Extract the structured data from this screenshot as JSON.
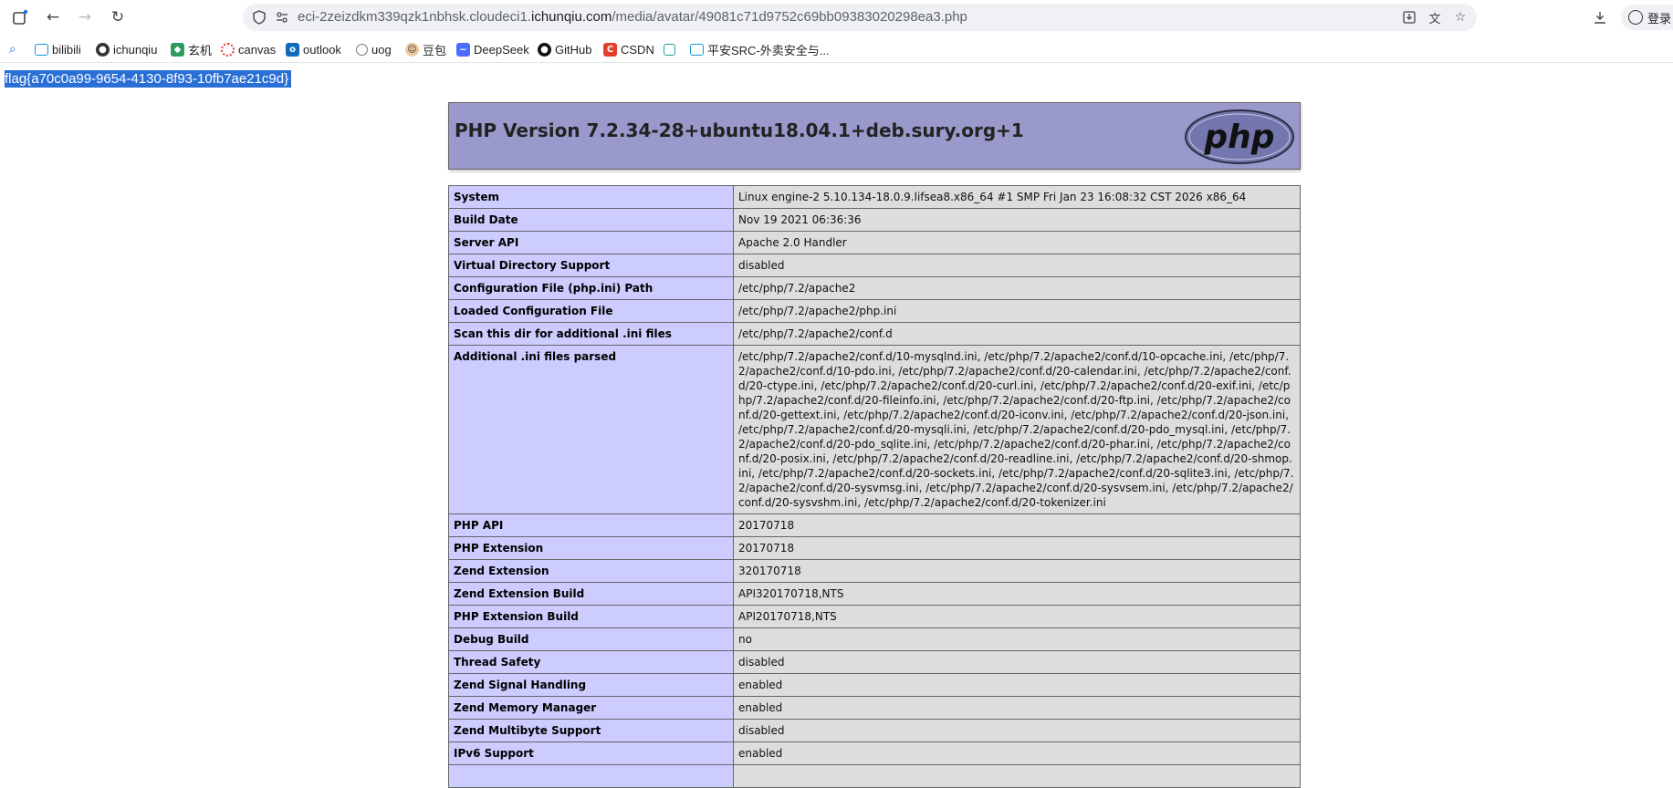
{
  "browser": {
    "url_prefix": "eci-2zeizdkm339qzk1nbhsk.cloudeci1.",
    "url_host": "ichunqiu.com",
    "url_path": "/media/avatar/49081c71d9752c69bb09383020298ea3.php",
    "profile_label": "登录",
    "bookmarks": [
      "bilibili",
      "ichunqiu",
      "玄机",
      "canvas",
      "outlook",
      "uog",
      "豆包",
      "DeepSeek",
      "GitHub",
      "CSDN",
      "",
      "平安SRC-外卖安全与..."
    ]
  },
  "page": {
    "flag": "flag{a70c0a99-9654-4130-8f93-10fb7ae21c9d}",
    "php_version_title": "PHP Version 7.2.34-28+ubuntu18.04.1+deb.sury.org+1",
    "logo_text": "php",
    "rows": [
      {
        "key": "System",
        "value": "Linux engine-2 5.10.134-18.0.9.lifsea8.x86_64 #1 SMP Fri Jan 23 16:08:32 CST 2026 x86_64"
      },
      {
        "key": "Build Date",
        "value": "Nov 19 2021 06:36:36"
      },
      {
        "key": "Server API",
        "value": "Apache 2.0 Handler"
      },
      {
        "key": "Virtual Directory Support",
        "value": "disabled"
      },
      {
        "key": "Configuration File (php.ini) Path",
        "value": "/etc/php/7.2/apache2"
      },
      {
        "key": "Loaded Configuration File",
        "value": "/etc/php/7.2/apache2/php.ini"
      },
      {
        "key": "Scan this dir for additional .ini files",
        "value": "/etc/php/7.2/apache2/conf.d"
      },
      {
        "key": "Additional .ini files parsed",
        "value": "/etc/php/7.2/apache2/conf.d/10-mysqlnd.ini, /etc/php/7.2/apache2/conf.d/10-opcache.ini, /etc/php/7.2/apache2/conf.d/10-pdo.ini, /etc/php/7.2/apache2/conf.d/20-calendar.ini, /etc/php/7.2/apache2/conf.d/20-ctype.ini, /etc/php/7.2/apache2/conf.d/20-curl.ini, /etc/php/7.2/apache2/conf.d/20-exif.ini, /etc/php/7.2/apache2/conf.d/20-fileinfo.ini, /etc/php/7.2/apache2/conf.d/20-ftp.ini, /etc/php/7.2/apache2/conf.d/20-gettext.ini, /etc/php/7.2/apache2/conf.d/20-iconv.ini, /etc/php/7.2/apache2/conf.d/20-json.ini, /etc/php/7.2/apache2/conf.d/20-mysqli.ini, /etc/php/7.2/apache2/conf.d/20-pdo_mysql.ini, /etc/php/7.2/apache2/conf.d/20-pdo_sqlite.ini, /etc/php/7.2/apache2/conf.d/20-phar.ini, /etc/php/7.2/apache2/conf.d/20-posix.ini, /etc/php/7.2/apache2/conf.d/20-readline.ini, /etc/php/7.2/apache2/conf.d/20-shmop.ini, /etc/php/7.2/apache2/conf.d/20-sockets.ini, /etc/php/7.2/apache2/conf.d/20-sqlite3.ini, /etc/php/7.2/apache2/conf.d/20-sysvmsg.ini, /etc/php/7.2/apache2/conf.d/20-sysvsem.ini, /etc/php/7.2/apache2/conf.d/20-sysvshm.ini, /etc/php/7.2/apache2/conf.d/20-tokenizer.ini"
      },
      {
        "key": "PHP API",
        "value": "20170718"
      },
      {
        "key": "PHP Extension",
        "value": "20170718"
      },
      {
        "key": "Zend Extension",
        "value": "320170718"
      },
      {
        "key": "Zend Extension Build",
        "value": "API320170718,NTS"
      },
      {
        "key": "PHP Extension Build",
        "value": "API20170718,NTS"
      },
      {
        "key": "Debug Build",
        "value": "no"
      },
      {
        "key": "Thread Safety",
        "value": "disabled"
      },
      {
        "key": "Zend Signal Handling",
        "value": "enabled"
      },
      {
        "key": "Zend Memory Manager",
        "value": "enabled"
      },
      {
        "key": "Zend Multibyte Support",
        "value": "disabled"
      },
      {
        "key": "IPv6 Support",
        "value": "enabled"
      }
    ]
  }
}
